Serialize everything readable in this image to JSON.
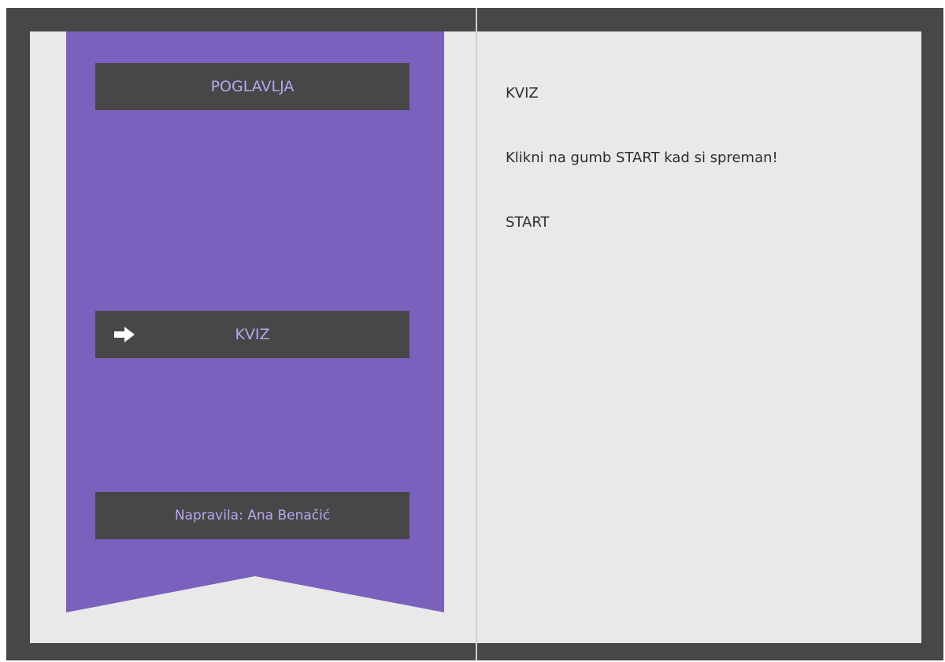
{
  "navigation": {
    "chapters_label": "POGLAVLJA",
    "quiz_label": "KVIZ",
    "author_label": "Napravila: Ana Benačić",
    "arrow_icon": "arrow-right-icon"
  },
  "content": {
    "title": "KVIZ",
    "instruction": "Klikni na gumb START kad si spreman!",
    "start_label": "START"
  },
  "colors": {
    "frame": "#474747",
    "page": "#e9e9e9",
    "ribbon": "#7a61bd",
    "button_text": "#b9a6ef",
    "body_text": "#2e2e2e"
  }
}
